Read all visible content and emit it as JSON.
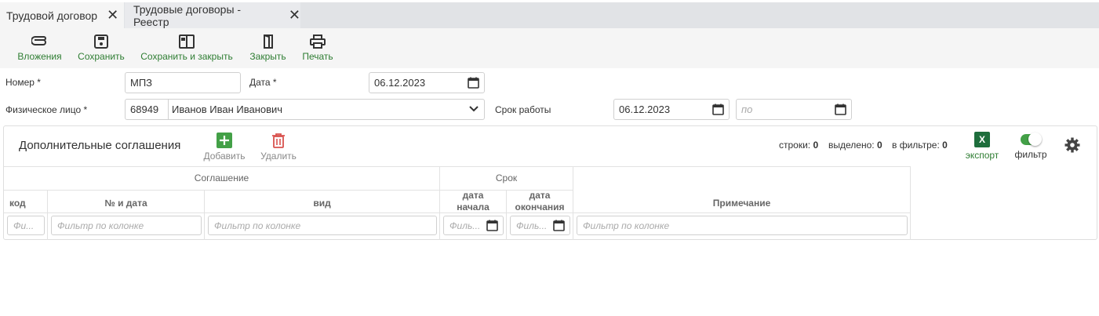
{
  "tabs": [
    {
      "label": "Трудовой договор",
      "active": true
    },
    {
      "label": "Трудовые договоры - Реестр",
      "active": false
    }
  ],
  "close_glyph": "✕",
  "toolbar": {
    "attachments": "Вложения",
    "save": "Сохранить",
    "save_close": "Сохранить и закрыть",
    "close": "Закрыть",
    "print": "Печать"
  },
  "form": {
    "number_label": "Номер *",
    "number_value": "МПЗ",
    "date_label": "Дата *",
    "date_value": "06.12.2023",
    "person_label": "Физическое лицо *",
    "person_code": "68949",
    "person_name": "Иванов Иван Иванович",
    "term_label": "Срок работы",
    "term_from": "06.12.2023",
    "term_to_placeholder": "по"
  },
  "agreements": {
    "title": "Дополнительные соглашения",
    "add_label": "Добавить",
    "delete_label": "Удалить",
    "rows_label": "строки:",
    "rows_value": "0",
    "selected_label": "выделено:",
    "selected_value": "0",
    "in_filter_label": "в фильтре:",
    "in_filter_value": "0",
    "export_label": "экспорт",
    "export_icon_text": "X",
    "filter_label": "фильтр",
    "filter_on": true,
    "group_headers": {
      "agreement": "Соглашение",
      "term": "Срок"
    },
    "columns": {
      "code": "код",
      "number_date": "№ и дата",
      "kind": "вид",
      "start_date": "дата начала",
      "end_date": "дата окончания",
      "note": "Примечание"
    },
    "filter_placeholder": "Фильтр по колонке",
    "filter_placeholder_short": "Фи...",
    "filter_placeholder_date": "Филь..."
  },
  "colors": {
    "accent_green": "#2e7d32",
    "add_green": "#43a047",
    "delete_red": "#d9534f",
    "excel_green": "#1e6e3c"
  }
}
